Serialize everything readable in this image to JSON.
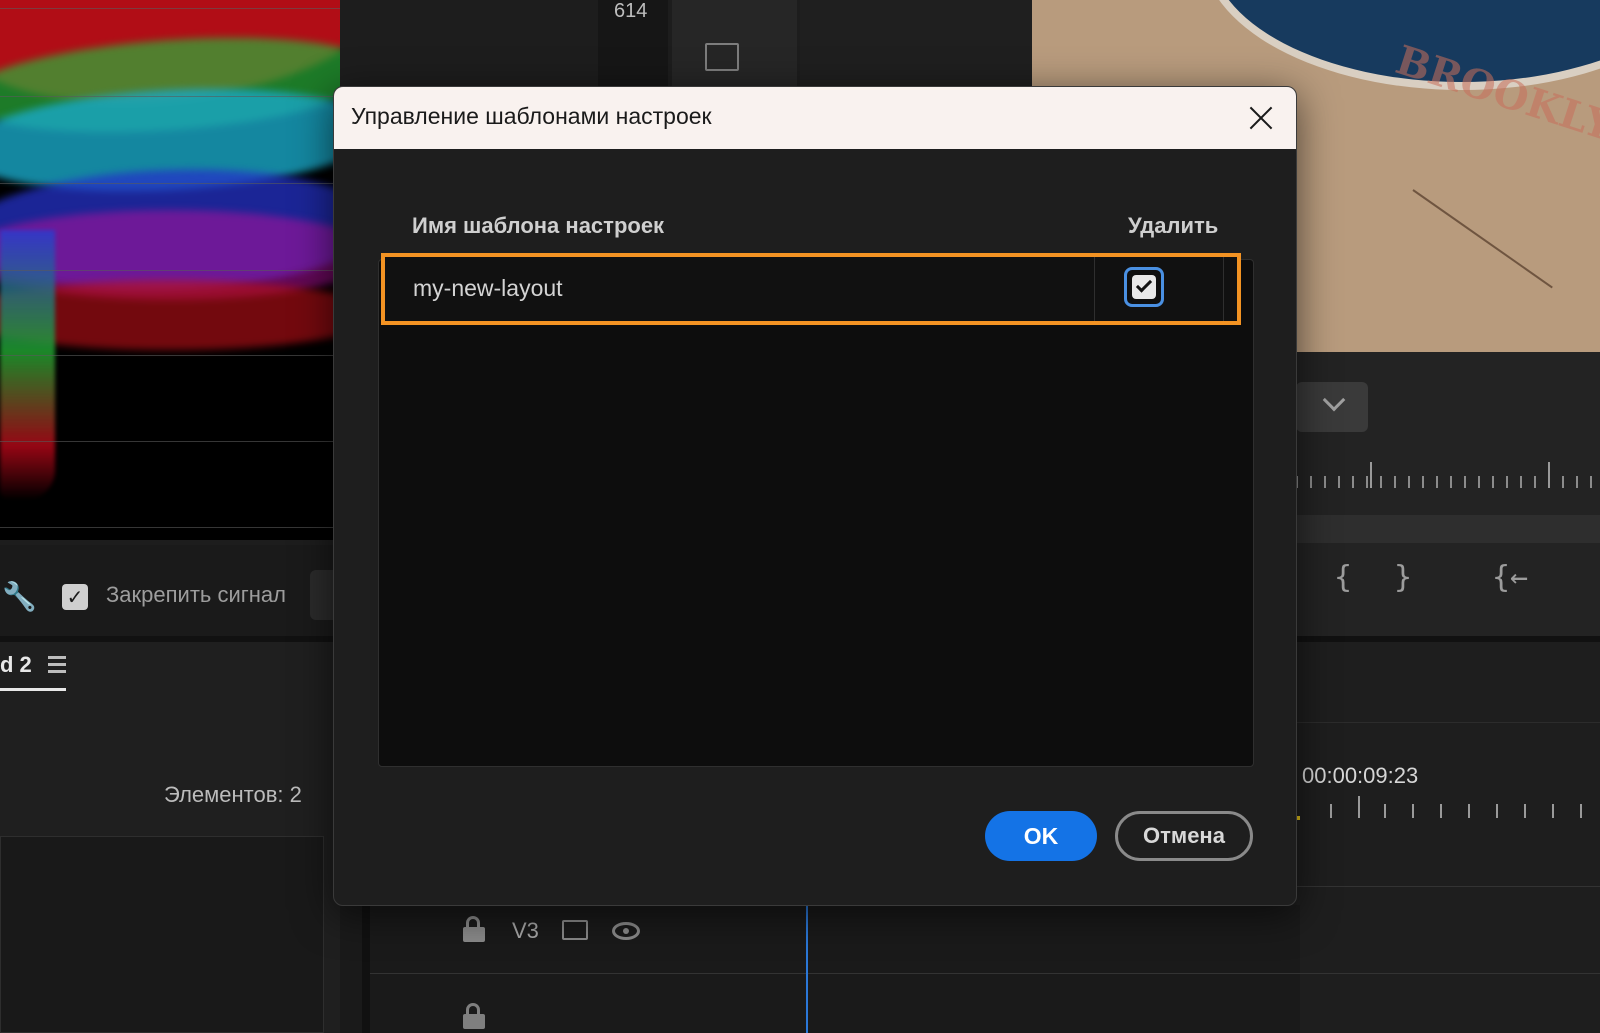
{
  "background": {
    "scope_value": "614",
    "lock_signal_label": "Закрепить сигнал",
    "sequence_tab": "d 2",
    "items_count": "Элементов: 2",
    "timecode": "00:00:09:23",
    "track_label": "V3",
    "graffiti": "BROOKLY"
  },
  "dialog": {
    "title": "Управление шаблонами настроек",
    "columns": {
      "name": "Имя шаблона настроек",
      "delete": "Удалить"
    },
    "rows": [
      {
        "name": "my-new-layout",
        "delete_checked": true
      }
    ],
    "ok_label": "OK",
    "cancel_label": "Отмена"
  },
  "colors": {
    "accent_blue": "#1473e6",
    "highlight_orange": "#f39323",
    "checkbox_focus": "#4a90e2",
    "playhead": "#2b78d8"
  }
}
